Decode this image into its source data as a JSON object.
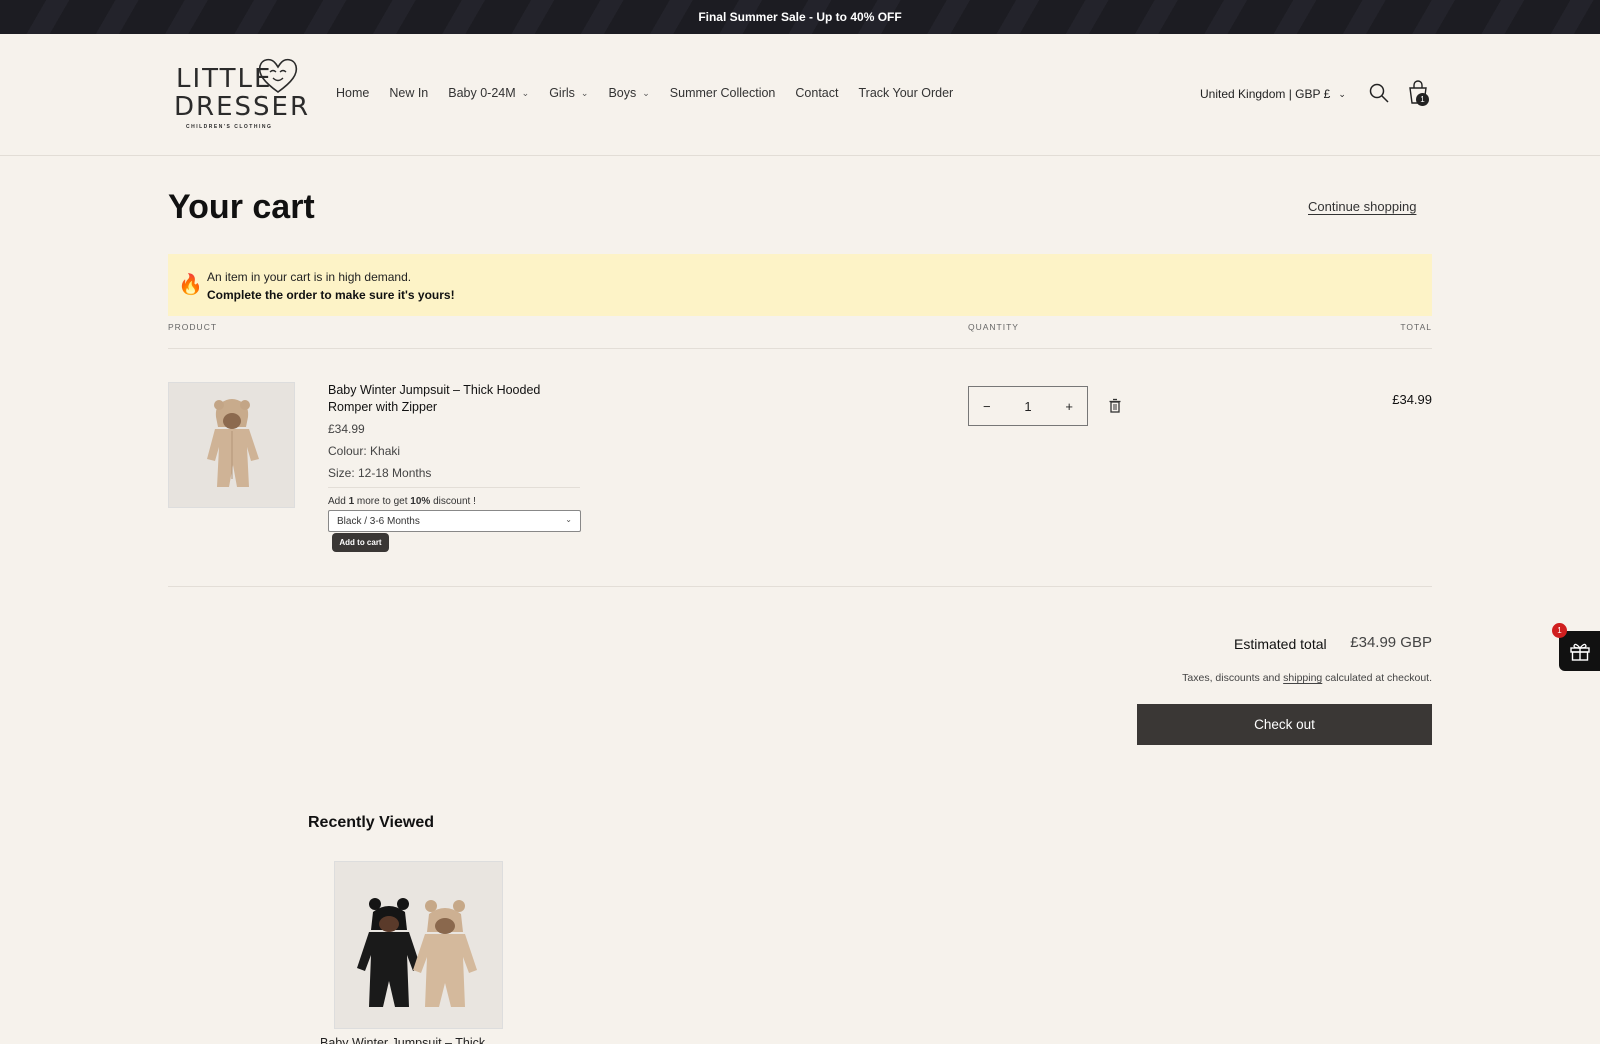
{
  "announcement": "Final Summer Sale - Up to 40% OFF",
  "brand": {
    "line1": "LITTLE",
    "line2": "DRESSER",
    "tagline": "CHILDREN'S CLOTHING"
  },
  "nav": {
    "items": [
      {
        "label": "Home",
        "dropdown": false
      },
      {
        "label": "New In",
        "dropdown": false
      },
      {
        "label": "Baby 0-24M",
        "dropdown": true
      },
      {
        "label": "Girls",
        "dropdown": true
      },
      {
        "label": "Boys",
        "dropdown": true
      },
      {
        "label": "Summer Collection",
        "dropdown": false
      },
      {
        "label": "Contact",
        "dropdown": false
      },
      {
        "label": "Track Your Order",
        "dropdown": false
      }
    ],
    "country": "United Kingdom | GBP £",
    "cart_count": "1"
  },
  "cart": {
    "title": "Your cart",
    "continue_label": "Continue shopping",
    "demand_line1": "An item in your cart is in high demand.",
    "demand_line2": "Complete the order to make sure it's yours!",
    "headers": {
      "product": "PRODUCT",
      "quantity": "QUANTITY",
      "total": "TOTAL"
    },
    "item": {
      "name": "Baby Winter Jumpsuit – Thick Hooded Romper with Zipper",
      "price": "£34.99",
      "colour": "Colour: Khaki",
      "size": "Size: 12-18 Months",
      "quantity": "1",
      "line_total": "£34.99"
    },
    "upsell": {
      "prefix": "Add ",
      "count": "1",
      "middle": " more to get ",
      "discount": "10%",
      "suffix": " discount !",
      "variant": "Black / 3-6 Months",
      "add_label": "Add to cart"
    },
    "estimated_label": "Estimated total",
    "estimated_value": "£34.99 GBP",
    "tax_prefix": "Taxes, discounts and ",
    "tax_link": "shipping",
    "tax_suffix": " calculated at checkout.",
    "checkout_label": "Check out"
  },
  "gift_badge": "1",
  "recently_viewed": {
    "title": "Recently Viewed",
    "items": [
      {
        "name": "Baby Winter Jumpsuit – Thick"
      }
    ]
  },
  "colors": {
    "background": "#f6f2ec",
    "announcement_bg": "#1c1c22",
    "demand_bg": "#fdf3c7",
    "button": "#3a3735",
    "badge": "#d01f1f"
  }
}
